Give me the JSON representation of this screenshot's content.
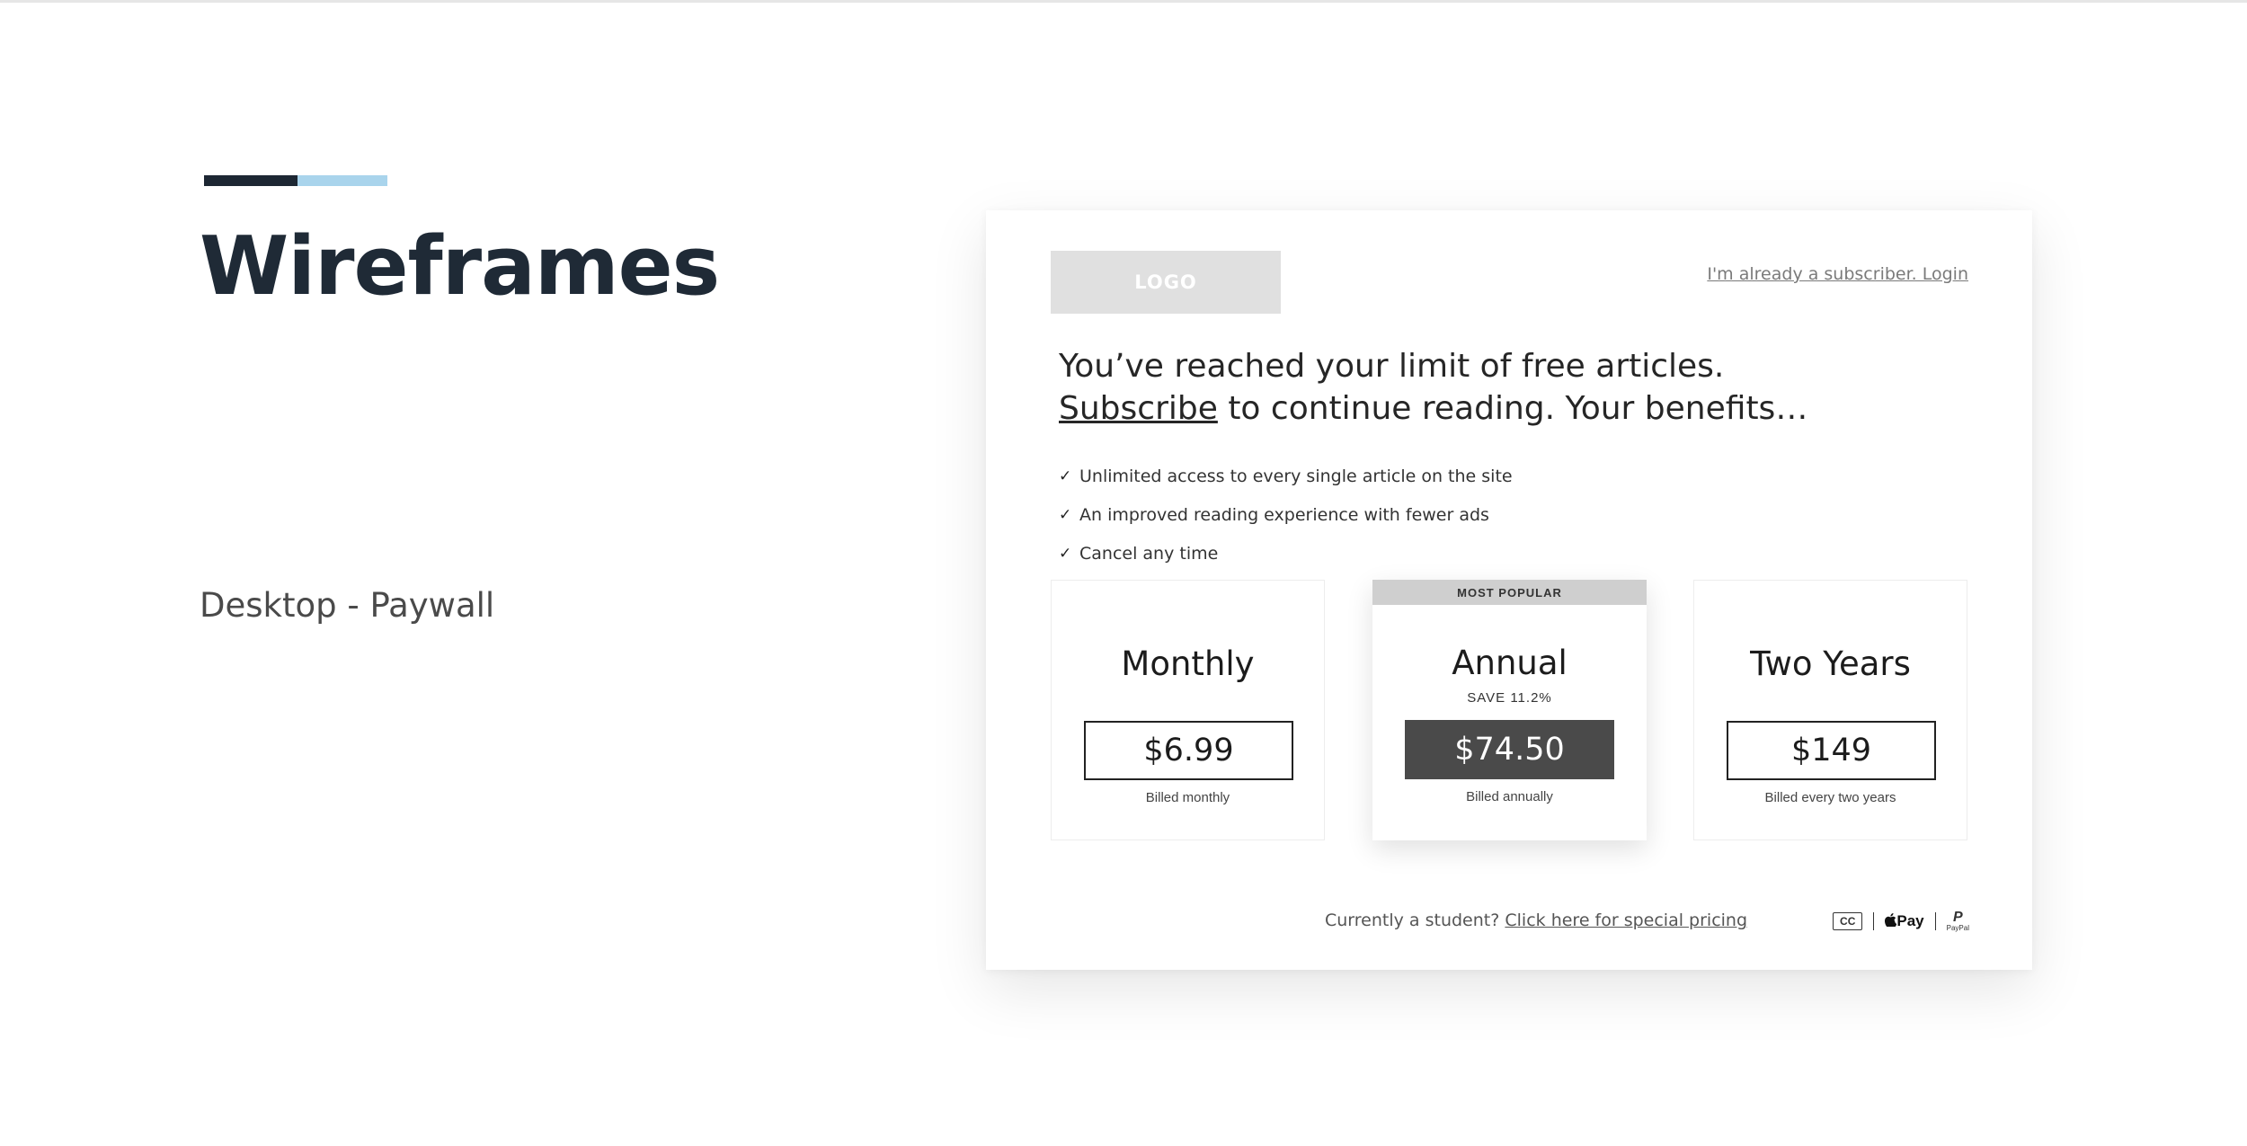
{
  "slide": {
    "title": "Wireframes",
    "subtitle": "Desktop - Paywall",
    "accent_colors": [
      "#1d2733",
      "#a9d4ec"
    ]
  },
  "paywall": {
    "logo_text": "LOGO",
    "login_link": "I'm already a subscriber. Login",
    "headline_line1": "You’ve reached your limit of free articles.",
    "headline_subscribe": "Subscribe",
    "headline_rest": " to continue reading. Your benefits…",
    "benefits": [
      "Unlimited access to every single article on the site",
      "An improved reading experience with fewer ads",
      "Cancel any time"
    ],
    "plans": [
      {
        "name": "Monthly",
        "price": "$6.99",
        "billed": "Billed monthly"
      },
      {
        "name": "Annual",
        "ribbon": "MOST POPULAR",
        "save": "SAVE 11.2%",
        "price": "$74.50",
        "billed": "Billed annually"
      },
      {
        "name": "Two Years",
        "price": "$149",
        "billed": "Billed every two years"
      }
    ],
    "student_text": "Currently a student?",
    "student_link": "Click here for special pricing",
    "payment_methods": {
      "cc": "CC",
      "apple_pay": "Pay",
      "paypal": "PayPal"
    }
  }
}
